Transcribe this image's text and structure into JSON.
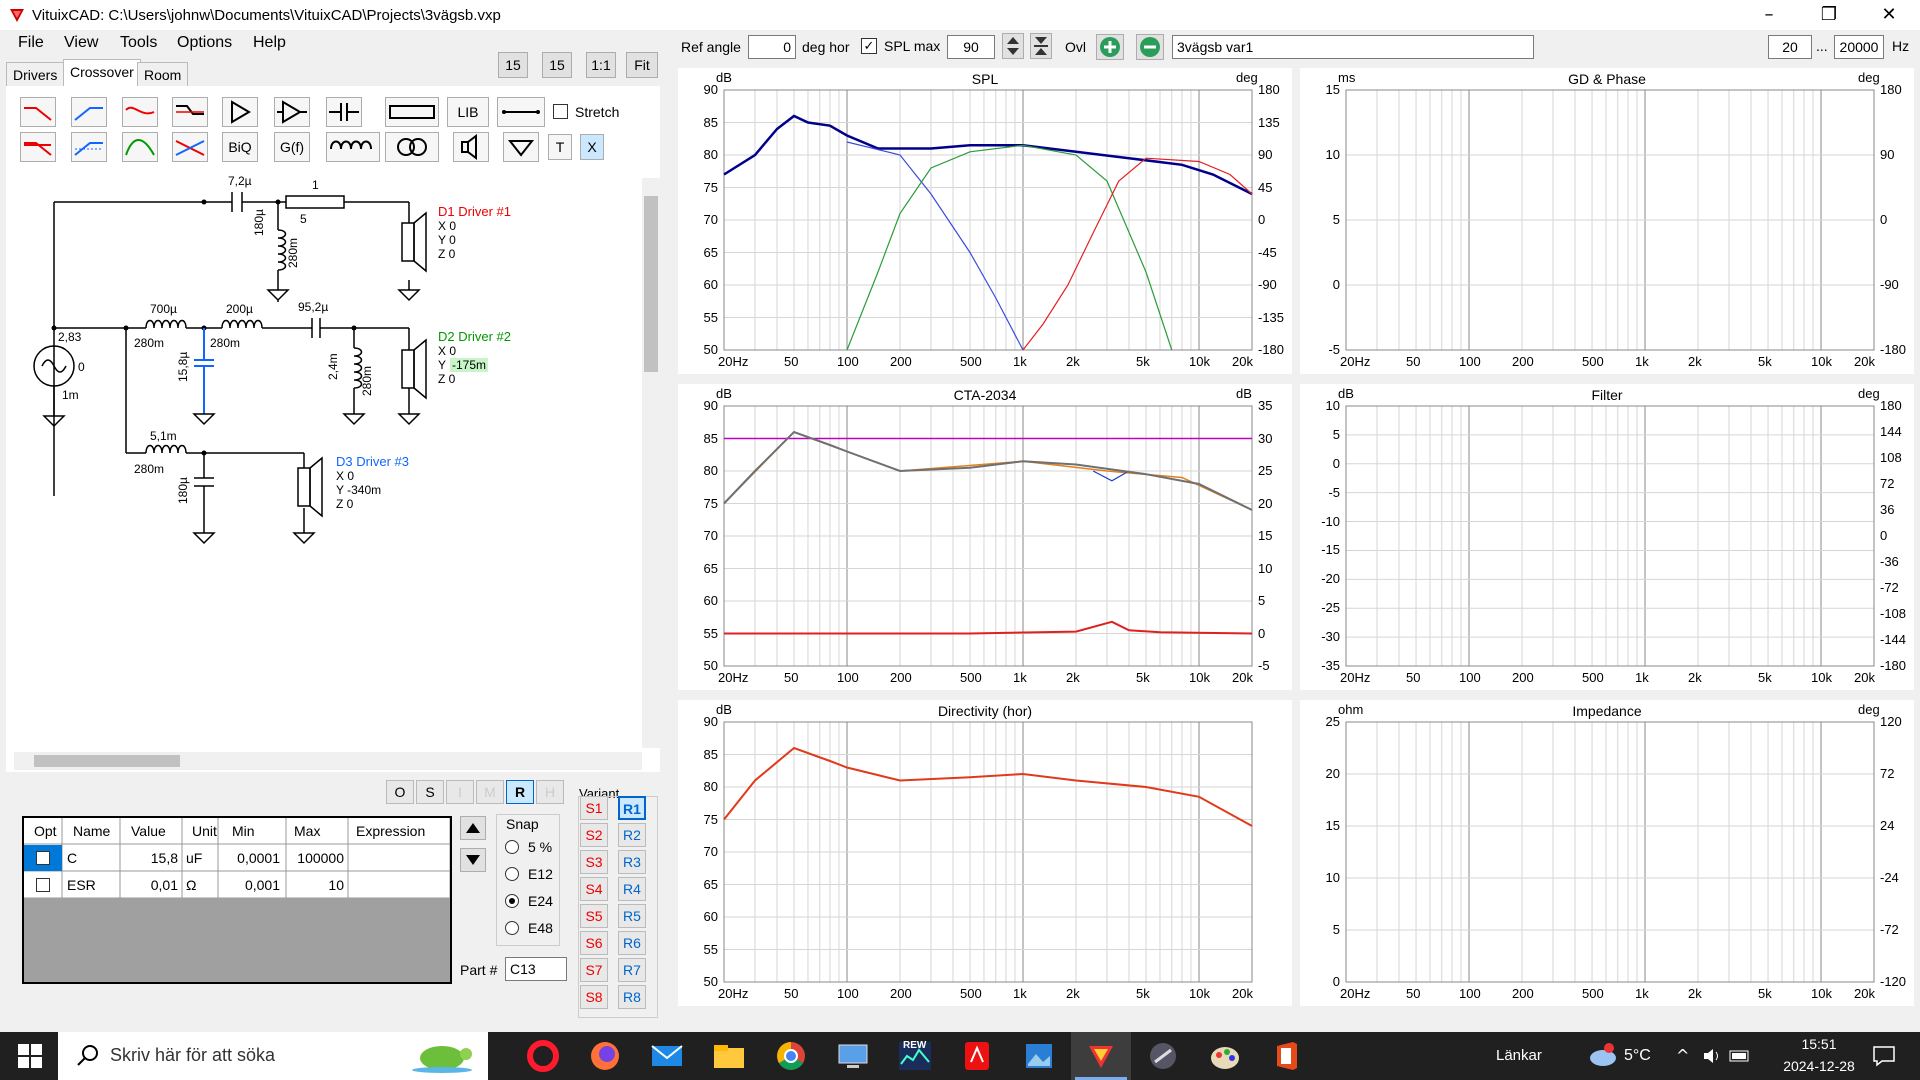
{
  "window": {
    "title": "VituixCAD: C:\\Users\\johnw\\Documents\\VituixCAD\\Projects\\3vägsb.vxp"
  },
  "menu": [
    "File",
    "View",
    "Tools",
    "Options",
    "Help"
  ],
  "tabs": [
    "Drivers",
    "Crossover",
    "Room"
  ],
  "zoom_buttons": {
    "a": "15",
    "b": "15",
    "one": "1:1",
    "fit": "Fit"
  },
  "toolbar": {
    "lib": "LIB",
    "biq": "BiQ",
    "gf": "G(f)",
    "t": "T",
    "x": "X",
    "stretch": "Stretch"
  },
  "topbar": {
    "ref_angle_label": "Ref angle",
    "ref_angle_value": "0",
    "deg_hor": "deg hor",
    "spl_max_label": "SPL max",
    "spl_max_value": "90",
    "ovl": "Ovl",
    "variant_name": "3vägsb var1",
    "f_low": "20",
    "ellipsis": "...",
    "f_high": "20000",
    "hz": "Hz"
  },
  "schematic": {
    "c1": "7,2µ",
    "r1": "1",
    "r1b": "5",
    "l1": "180µ",
    "l1r": "280m",
    "d1_name": "D1 Driver #1",
    "d1_x": "X 0",
    "d1_y": "Y 0",
    "d1_z": "Z 0",
    "l2": "700µ",
    "l2r": "280m",
    "l3": "200µ",
    "l3r": "280m",
    "c2": "95,2µ",
    "c3": "15,8µ",
    "l4": "2,4m",
    "l4r": "280m",
    "d2_name": "D2 Driver #2",
    "d2_x": "X 0",
    "d2_y": "Y",
    "d2_yval": "-175m",
    "d2_z": "Z 0",
    "src_v": "2,83",
    "src_o": "0",
    "src_r": "1m",
    "l5": "5,1m",
    "l5r": "280m",
    "c4": "180µ",
    "d3_name": "D3 Driver #3",
    "d3_x": "X 0",
    "d3_y": "Y -340m",
    "d3_z": "Z 0"
  },
  "part_buttons": [
    "O",
    "S",
    "I",
    "M",
    "R",
    "H"
  ],
  "part_table": {
    "headers": [
      "Opt",
      "Name",
      "Value",
      "Unit",
      "Min",
      "Max",
      "Expression"
    ],
    "rows": [
      {
        "name": "C",
        "value": "15,8",
        "unit": "uF",
        "min": "0,0001",
        "max": "100000",
        "expr": ""
      },
      {
        "name": "ESR",
        "value": "0,01",
        "unit": "Ω",
        "min": "0,001",
        "max": "10",
        "expr": ""
      }
    ]
  },
  "snap": {
    "label": "Snap",
    "options": [
      "5 %",
      "E12",
      "E24",
      "E48"
    ],
    "selected": "E24"
  },
  "part_no": {
    "label": "Part #",
    "value": "C13"
  },
  "variant": {
    "label": "Variant",
    "s": [
      "S1",
      "S2",
      "S3",
      "S4",
      "S5",
      "S6",
      "S7",
      "S8"
    ],
    "r": [
      "R1",
      "R2",
      "R3",
      "R4",
      "R5",
      "R6",
      "R7",
      "R8"
    ]
  },
  "xticks": [
    "20Hz",
    "50",
    "100",
    "200",
    "500",
    "1k",
    "2k",
    "5k",
    "10k",
    "20k"
  ],
  "plots": {
    "spl": {
      "title": "SPL",
      "lunit": "dB",
      "runit": "deg",
      "left": [
        "90",
        "85",
        "80",
        "75",
        "70",
        "65",
        "60",
        "55",
        "50"
      ],
      "right": [
        "180",
        "135",
        "90",
        "45",
        "0",
        "-45",
        "-90",
        "-135",
        "-180"
      ]
    },
    "gd": {
      "title": "GD & Phase",
      "lunit": "ms",
      "runit": "deg",
      "left": [
        "15",
        "10",
        "5",
        "0",
        "-5"
      ],
      "right": [
        "180",
        "90",
        "0",
        "-90",
        "-180"
      ]
    },
    "cta": {
      "title": "CTA-2034",
      "lunit": "dB",
      "runit": "dB",
      "left": [
        "90",
        "85",
        "80",
        "75",
        "70",
        "65",
        "60",
        "55",
        "50"
      ],
      "right": [
        "35",
        "30",
        "25",
        "20",
        "15",
        "10",
        "5",
        "0",
        "-5"
      ]
    },
    "filter": {
      "title": "Filter",
      "lunit": "dB",
      "runit": "deg",
      "left": [
        "10",
        "5",
        "0",
        "-5",
        "-10",
        "-15",
        "-20",
        "-25",
        "-30",
        "-35"
      ],
      "right": [
        "180",
        "144",
        "108",
        "72",
        "36",
        "0",
        "-36",
        "-72",
        "-108",
        "-144",
        "-180"
      ]
    },
    "dir": {
      "title": "Directivity (hor)",
      "lunit": "dB",
      "left": [
        "90",
        "85",
        "80",
        "75",
        "70",
        "65",
        "60",
        "55",
        "50"
      ]
    },
    "imp": {
      "title": "Impedance",
      "lunit": "ohm",
      "runit": "deg",
      "left": [
        "25",
        "20",
        "15",
        "10",
        "5",
        "0"
      ],
      "right": [
        "120",
        "72",
        "24",
        "-24",
        "-72",
        "-120"
      ]
    }
  },
  "taskbar": {
    "search": "Skriv här för att söka",
    "links": "Länkar",
    "temp": "5°C",
    "time": "15:51",
    "date": "2024-12-28",
    "rew": "REW"
  }
}
